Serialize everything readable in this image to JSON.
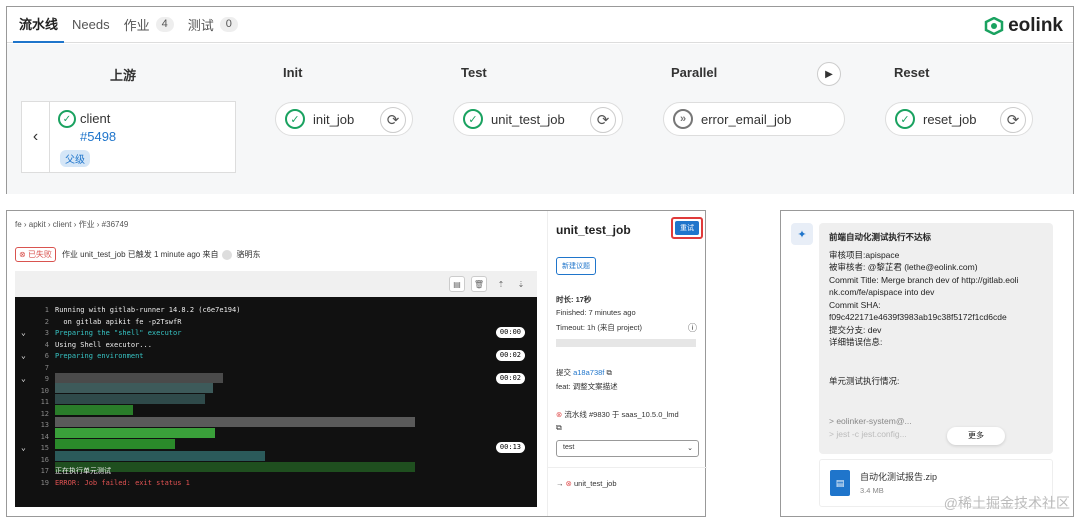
{
  "tabs": [
    {
      "label": "流水线",
      "count": null
    },
    {
      "label": "Needs",
      "count": null
    },
    {
      "label": "作业",
      "count": "4"
    },
    {
      "label": "测试",
      "count": "0"
    }
  ],
  "logo": {
    "text": "eolink"
  },
  "stages": [
    {
      "title": "上游"
    },
    {
      "title": "Init"
    },
    {
      "title": "Test"
    },
    {
      "title": "Parallel"
    },
    {
      "title": "Reset"
    }
  ],
  "upstream": {
    "name": "client",
    "id": "#5498",
    "badge": "父级"
  },
  "jobs": {
    "init": "init_job",
    "test": "unit_test_job",
    "parallel": "error_email_job",
    "reset": "reset_job"
  },
  "job": {
    "breadcrumb": "fe › apkit › client › 作业 › #36749",
    "status": "已失败",
    "status_text": "作业 unit_test_job 已触发 1 minute ago 来自",
    "user": "骆明东",
    "title": "unit_test_job",
    "retry_label": "重试",
    "new_issue_label": "新建议题",
    "duration": "时长: 17秒",
    "finished": "Finished: 7 minutes ago",
    "timeout": "Timeout: 1h (来自 project)",
    "commit_prefix": "提交",
    "commit_sha": "a18a738f",
    "commit_msg": "feat: 调整文案描述",
    "pipeline": "流水线 #9830 于 saas_10.5.0_lmd",
    "stage_select": "test",
    "related_job": "unit_test_job"
  },
  "log": [
    {
      "n": "1",
      "text": "Running with gitlab-runner 14.8.2 (c6e7e194)",
      "cls": "",
      "caret": false,
      "time": ""
    },
    {
      "n": "2",
      "text": "  on gitlab apikit fe -p2TswfR",
      "cls": "",
      "caret": false,
      "time": ""
    },
    {
      "n": "3",
      "text": "Preparing the \"shell\" executor",
      "cls": "cyan",
      "caret": true,
      "time": "00:00"
    },
    {
      "n": "4",
      "text": "Using Shell executor...",
      "cls": "",
      "caret": false,
      "time": ""
    },
    {
      "n": "6",
      "text": "Preparing environment",
      "cls": "cyan",
      "caret": true,
      "time": "00:02"
    },
    {
      "n": "7",
      "text": "",
      "cls": "",
      "caret": false,
      "time": ""
    },
    {
      "n": "9",
      "text": "",
      "cls": "",
      "caret": true,
      "time": "00:02"
    },
    {
      "n": "10",
      "text": "",
      "cls": "",
      "caret": false,
      "time": ""
    },
    {
      "n": "11",
      "text": "",
      "cls": "",
      "caret": false,
      "time": ""
    },
    {
      "n": "12",
      "text": "",
      "cls": "",
      "caret": false,
      "time": ""
    },
    {
      "n": "13",
      "text": "",
      "cls": "",
      "caret": false,
      "time": ""
    },
    {
      "n": "14",
      "text": "",
      "cls": "",
      "caret": false,
      "time": ""
    },
    {
      "n": "15",
      "text": "",
      "cls": "",
      "caret": true,
      "time": "00:13"
    },
    {
      "n": "16",
      "text": "",
      "cls": "",
      "caret": false,
      "time": ""
    },
    {
      "n": "17",
      "text": "正在执行单元测试",
      "cls": "",
      "caret": false,
      "time": ""
    },
    {
      "n": "19",
      "text": "ERROR: Job failed: exit status 1",
      "cls": "red",
      "caret": false,
      "time": ""
    }
  ],
  "chat": {
    "title": "前端自动化测试执行不达标",
    "lines": [
      "审核项目:apispace",
      "被审核者: @黎芷君 (lethe@eolink.com)",
      "Commit Title: Merge branch dev of http://gitlab.eoli",
      "nk.com/fe/apispace into dev",
      "Commit SHA:",
      "f09c422171e4639f3983ab19c38f5172f1cd6cde",
      "提交分支: dev",
      "详细错误信息:",
      "",
      "单元测试执行情况:",
      "",
      "> eolinker-system@...",
      "> jest -c jest.config..."
    ],
    "more_label": "更多",
    "file_name": "自动化测试报告.zip",
    "file_size": "3.4 MB",
    "watermark": "@稀土掘金技术社区"
  }
}
